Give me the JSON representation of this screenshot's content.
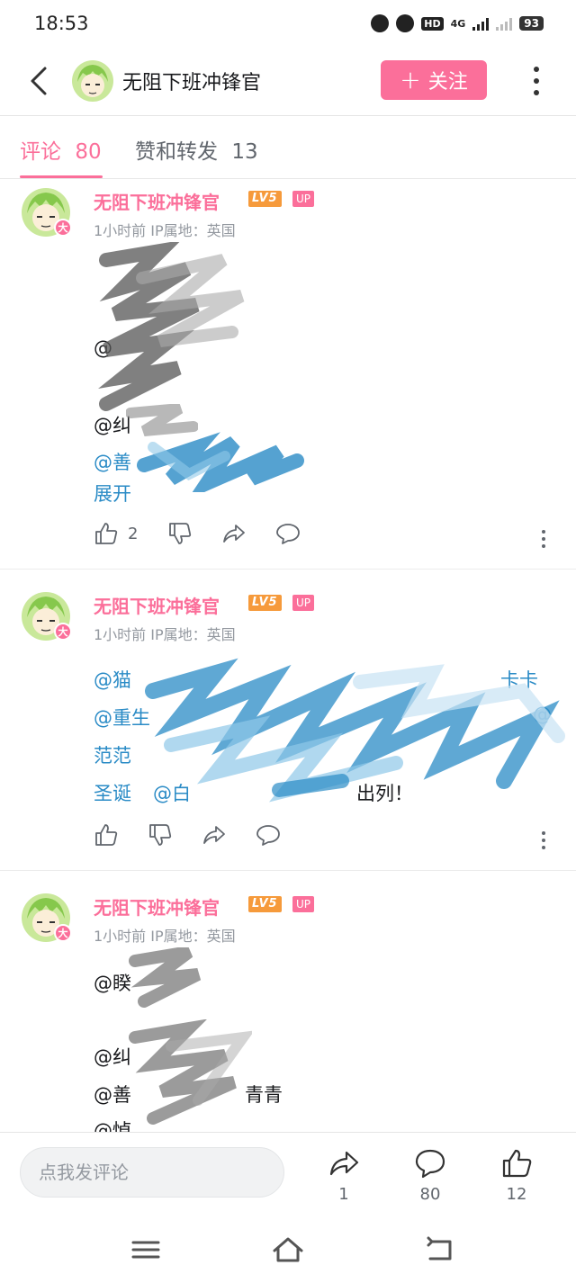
{
  "status_bar": {
    "time": "18:53",
    "hd_label": "HD",
    "net_label": "4G",
    "battery": "93"
  },
  "header": {
    "title": "无阻下班冲锋官",
    "follow_label": "关注",
    "follow_plus": "+"
  },
  "tabs": [
    {
      "label": "评论",
      "count": "80",
      "active": true
    },
    {
      "label": "赞和转发",
      "count": "13",
      "active": false
    }
  ],
  "comments": [
    {
      "user": "无阻下班冲锋官",
      "level": "LV5",
      "up_badge": "UP",
      "avatar_badge": "大",
      "meta": "1小时前  IP属地：英国",
      "lines": [
        "@",
        "@纠",
        "@善",
        "展开"
      ],
      "like_count": "2"
    },
    {
      "user": "无阻下班冲锋官",
      "level": "LV5",
      "up_badge": "UP",
      "avatar_badge": "大",
      "meta": "1小时前  IP属地：英国",
      "line1_a": "@猫",
      "line1_b": "卡卡",
      "line2_a": "@重生",
      "line2_b": "@",
      "line3": "范范",
      "line4_a": "圣诞",
      "line4_b": "@白",
      "line4_c": "出列！",
      "like_count": ""
    },
    {
      "user": "无阻下班冲锋官",
      "level": "LV5",
      "up_badge": "UP",
      "avatar_badge": "大",
      "meta": "1小时前  IP属地：英国",
      "lines": [
        "@睽",
        "@纠",
        "@善",
        "青青",
        "@悼"
      ]
    }
  ],
  "bottom_bar": {
    "input_placeholder": "点我发评论",
    "share_count": "1",
    "comment_count": "80",
    "like_count": "12"
  },
  "colors": {
    "accent_pink": "#fb6f9a",
    "link_blue": "#2a8bc6",
    "level_orange": "#f69a3b",
    "text_gray": "#9499a0"
  }
}
